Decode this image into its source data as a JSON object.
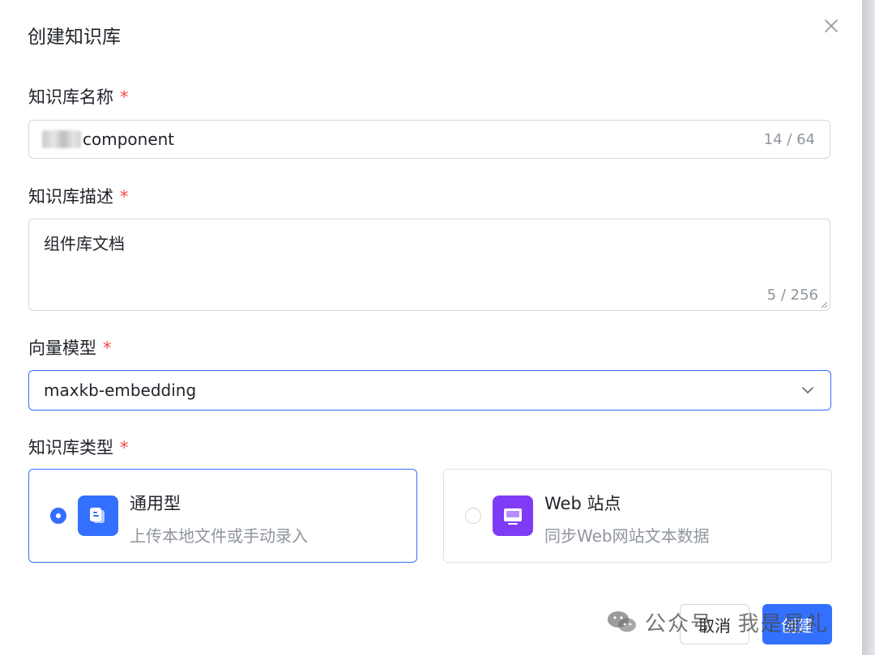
{
  "dialog": {
    "title": "创建知识库",
    "close_icon": "close-icon"
  },
  "name_field": {
    "label": "知识库名称",
    "required_mark": "*",
    "value": "component",
    "counter": "14 / 64"
  },
  "desc_field": {
    "label": "知识库描述",
    "required_mark": "*",
    "value": "组件库文档",
    "counter": "5 / 256"
  },
  "model_field": {
    "label": "向量模型",
    "required_mark": "*",
    "selected": "maxkb-embedding",
    "icon": "chevron-down-icon"
  },
  "type_field": {
    "label": "知识库类型",
    "required_mark": "*",
    "options": [
      {
        "title": "通用型",
        "description": "上传本地文件或手动录入",
        "icon": "document-icon",
        "selected": true
      },
      {
        "title": "Web 站点",
        "description": "同步Web网站文本数据",
        "icon": "web-monitor-icon",
        "selected": false
      }
    ]
  },
  "footer": {
    "cancel_label": "取消",
    "create_label": "创建"
  },
  "watermark": {
    "text": "公众号 · 我是星礼",
    "icon": "wechat-icon"
  },
  "colors": {
    "primary": "#3370ff",
    "required": "#f54a45",
    "muted_text": "#8f959e",
    "web_icon_bg": "#7f3bf5"
  }
}
